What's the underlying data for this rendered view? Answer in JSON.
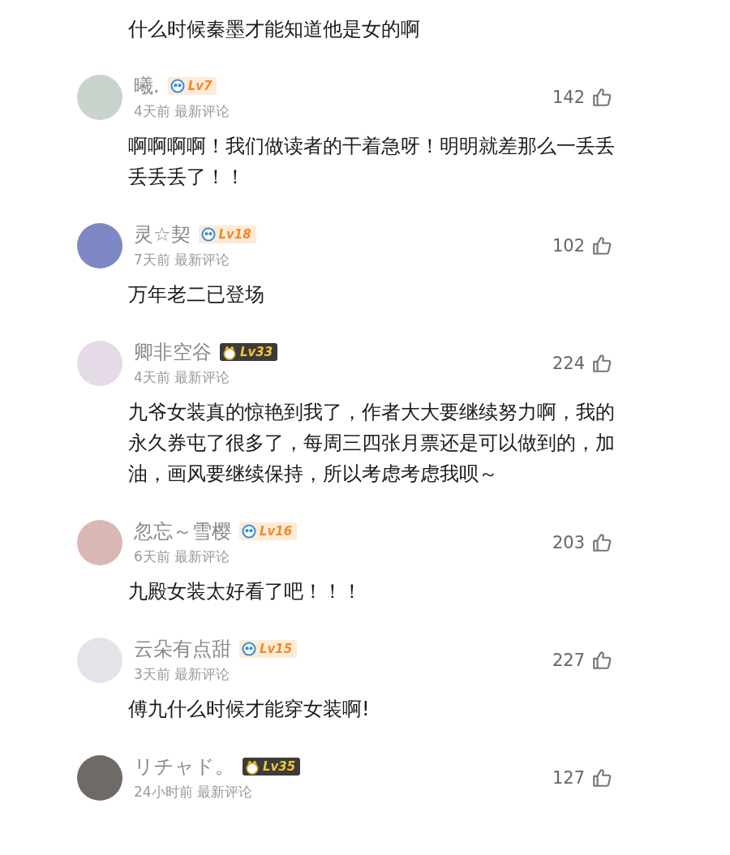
{
  "previous_comment_text": "什么时候秦墨才能知道他是女的啊",
  "comments": [
    {
      "username": "曦.",
      "badge": {
        "kind": "plain",
        "label": "Lv7"
      },
      "meta": "4天前 最新评论",
      "likes": "142",
      "text": "啊啊啊啊！我们做读者的干着急呀！明明就差那么一丢丢丢丢丢了！！"
    },
    {
      "username": "灵☆契",
      "badge": {
        "kind": "plain",
        "label": "Lv18"
      },
      "meta": "7天前 最新评论",
      "likes": "102",
      "text": "万年老二已登场"
    },
    {
      "username": "卿非空谷",
      "badge": {
        "kind": "crown",
        "label": "Lv33"
      },
      "meta": "4天前 最新评论",
      "likes": "224",
      "text": "九爷女装真的惊艳到我了，作者大大要继续努力啊，我的永久券屯了很多了，每周三四张月票还是可以做到的，加油，画风要继续保持，所以考虑考虑我呗～"
    },
    {
      "username": "忽忘～雪樱",
      "badge": {
        "kind": "plain",
        "label": "Lv16"
      },
      "meta": "6天前 最新评论",
      "likes": "203",
      "text": "九殿女装太好看了吧！！！"
    },
    {
      "username": "云朵有点甜",
      "badge": {
        "kind": "plain",
        "label": "Lv15"
      },
      "meta": "3天前 最新评论",
      "likes": "227",
      "text": "傅九什么时候才能穿女装啊!"
    },
    {
      "username": "リチャド。",
      "badge": {
        "kind": "crown",
        "label": "Lv35"
      },
      "meta": "24小时前 最新评论",
      "likes": "127"
    }
  ]
}
